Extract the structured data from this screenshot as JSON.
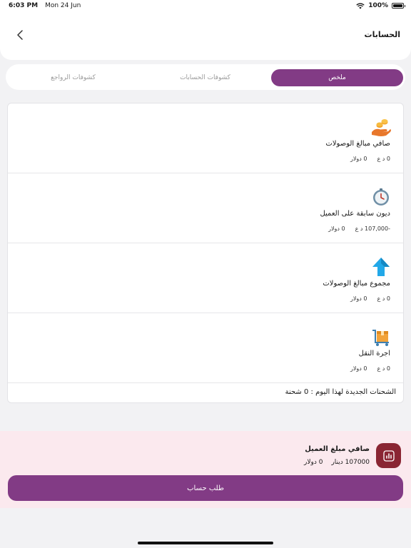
{
  "status_bar": {
    "time": "6:03 PM",
    "date": "Mon 24 Jun",
    "battery": "100%"
  },
  "header": {
    "title": "الحسابات",
    "back_icon": "chevron-left-icon"
  },
  "tabs": [
    {
      "label": "ملخص",
      "active": true
    },
    {
      "label": "كشوفات الحسابات",
      "active": false
    },
    {
      "label": "كشوفات الرواجع",
      "active": false
    }
  ],
  "items": [
    {
      "icon": "hand-coins-icon",
      "title": "صافي مبالغ الوصولات",
      "iqd": "0 د ع",
      "usd": "0 دولار"
    },
    {
      "icon": "clock-icon",
      "title": "ديون سابقة على العميل",
      "iqd": "-107,000 د ع",
      "usd": "0 دولار"
    },
    {
      "icon": "arrow-up-icon",
      "title": "مجموع مبالغ الوصولات",
      "iqd": "0 د ع",
      "usd": "0 دولار"
    },
    {
      "icon": "delivery-cart-icon",
      "title": "اجرة النقل",
      "iqd": "0 د ع",
      "usd": "0 دولار"
    }
  ],
  "shipments_today": "الشحنات الجديدة لهذا اليوم : 0 شحنة",
  "summary": {
    "icon": "chart-icon",
    "title": "صافي مبلغ العميل",
    "dinar": "107000 دينار",
    "dollar": "0 دولار",
    "button_label": "طلب حساب"
  },
  "colors": {
    "accent": "#823b85",
    "summary_bg": "#fbe9ee",
    "summary_icon_bg": "#8a2533"
  }
}
